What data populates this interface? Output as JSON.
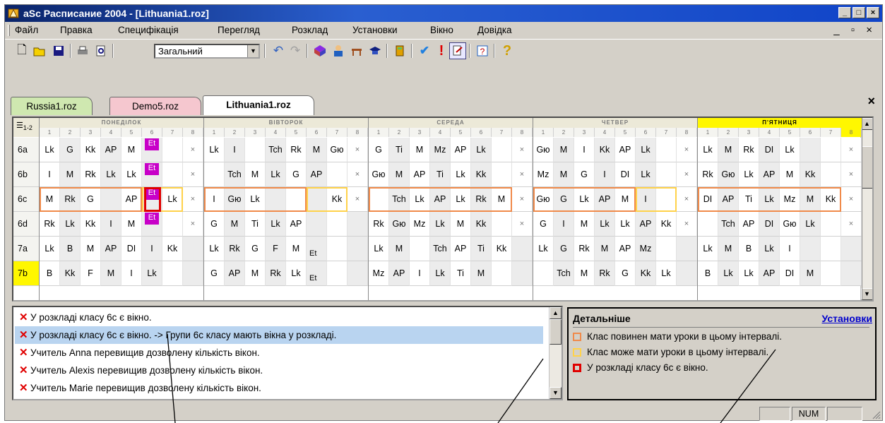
{
  "window": {
    "title": "aSc Расписание 2004  - [Lithuania1.roz]"
  },
  "menu": [
    "Файл",
    "Правка",
    "Специфікація",
    "Перегляд",
    "Розклад",
    "Установки",
    "Вікно",
    "Довідка"
  ],
  "toolbar": {
    "combo_value": "Загальний",
    "buttons": [
      "new-icon",
      "open-icon",
      "save-icon",
      "print-icon",
      "preview-icon",
      "undo-icon",
      "redo-icon",
      "subjects-icon",
      "teachers-icon",
      "classrooms-icon",
      "classes-icon",
      "generate-icon",
      "check-icon",
      "warning-icon",
      "edit-cards-icon",
      "help-tips-icon",
      "help-icon"
    ]
  },
  "tabs": [
    {
      "label": "Russia1.roz",
      "color": "#cfe8b0",
      "active": false
    },
    {
      "label": "Demo5.roz",
      "color": "#f5c7cf",
      "active": false
    },
    {
      "label": "Lithuania1.roz",
      "color": "#ffffff",
      "active": true
    }
  ],
  "grid": {
    "corner_label": "1-2",
    "days": [
      {
        "name": "ПОНЕДІЛОК",
        "highlight": false
      },
      {
        "name": "ВІВТОРОК",
        "highlight": false
      },
      {
        "name": "СЕРЕДА",
        "highlight": false
      },
      {
        "name": "ЧЕТВЕР",
        "highlight": false
      },
      {
        "name": "П'ЯТНИЦЯ",
        "highlight": true
      }
    ],
    "periods": [
      "1",
      "2",
      "3",
      "4",
      "5",
      "6",
      "7",
      "8"
    ],
    "rows": [
      {
        "cls": "6a",
        "days": [
          [
            "Lk",
            "G",
            "Kk",
            "AP",
            "M",
            "",
            "",
            "×"
          ],
          [
            "Lk",
            "I",
            "",
            "Tch",
            "Rk",
            "M",
            "Gю",
            "×"
          ],
          [
            "G",
            "Ti",
            "M",
            "Mz",
            "AP",
            "Lk",
            "",
            "×"
          ],
          [
            "Gю",
            "M",
            "I",
            "Kk",
            "AP",
            "Lk",
            "",
            "×"
          ],
          [
            "Lk",
            "M",
            "Rk",
            "DI",
            "Lk",
            "",
            "",
            "×"
          ]
        ]
      },
      {
        "cls": "6b",
        "days": [
          [
            "I",
            "M",
            "Rk",
            "Lk",
            "Lk",
            "",
            "",
            "×"
          ],
          [
            "",
            "Tch",
            "M",
            "Lk",
            "G",
            "AP",
            "",
            "×"
          ],
          [
            "Gю",
            "M",
            "AP",
            "Ti",
            "Lk",
            "Kk",
            "",
            "×"
          ],
          [
            "Mz",
            "M",
            "G",
            "I",
            "DI",
            "Lk",
            "",
            "×"
          ],
          [
            "Rk",
            "Gю",
            "Lk",
            "AP",
            "M",
            "Kk",
            "",
            "×"
          ]
        ]
      },
      {
        "cls": "6c",
        "days": [
          [
            "M",
            "Rk",
            "G",
            "",
            "AP",
            "",
            "Lk",
            "×"
          ],
          [
            "I",
            "Gю",
            "Lk",
            "",
            "",
            "",
            "Kk",
            "×"
          ],
          [
            "",
            "Tch",
            "Lk",
            "AP",
            "Lk",
            "Rk",
            "M",
            "×"
          ],
          [
            "Gю",
            "G",
            "Lk",
            "AP",
            "M",
            "I",
            "",
            "×"
          ],
          [
            "DI",
            "AP",
            "Ti",
            "Lk",
            "Mz",
            "M",
            "Kk",
            "×"
          ]
        ]
      },
      {
        "cls": "6d",
        "days": [
          [
            "Rk",
            "Lk",
            "Kk",
            "I",
            "M",
            "",
            "",
            "×"
          ],
          [
            "G",
            "M",
            "Ti",
            "Lk",
            "AP",
            "",
            "",
            ""
          ],
          [
            "Rk",
            "Gю",
            "Mz",
            "Lk",
            "M",
            "Kk",
            "",
            "×"
          ],
          [
            "G",
            "I",
            "M",
            "Lk",
            "Lk",
            "AP",
            "Kk",
            "×"
          ],
          [
            "",
            "Tch",
            "AP",
            "DI",
            "Gю",
            "Lk",
            "",
            "×"
          ]
        ]
      },
      {
        "cls": "7a",
        "days": [
          [
            "Lk",
            "B",
            "M",
            "AP",
            "DI",
            "I",
            "Kk",
            ""
          ],
          [
            "Lk",
            "Rk",
            "G",
            "F",
            "M",
            "",
            "",
            ""
          ],
          [
            "Lk",
            "M",
            "",
            "Tch",
            "AP",
            "Ti",
            "Kk",
            ""
          ],
          [
            "Lk",
            "G",
            "Rk",
            "M",
            "AP",
            "Mz",
            "",
            ""
          ],
          [
            "Lk",
            "M",
            "B",
            "Lk",
            "I",
            "",
            "",
            ""
          ]
        ]
      },
      {
        "cls": "7b",
        "days": [
          [
            "B",
            "Kk",
            "F",
            "M",
            "I",
            "Lk",
            "",
            ""
          ],
          [
            "G",
            "AP",
            "M",
            "Rk",
            "Lk",
            "",
            "",
            ""
          ],
          [
            "Mz",
            "AP",
            "I",
            "Lk",
            "Ti",
            "M",
            "",
            ""
          ],
          [
            "",
            "Tch",
            "M",
            "Rk",
            "G",
            "Kk",
            "Lk",
            ""
          ],
          [
            "B",
            "Lk",
            "Lk",
            "AP",
            "DI",
            "M",
            "",
            ""
          ]
        ]
      }
    ],
    "et_label": "Et"
  },
  "messages": [
    "У розкладі класу 6c є вікно.",
    "У розкладі класу 6c є вікно. -> Групи 6c класу мають вікна у розкладі.",
    "Учитель Anna перевищив дозволену кількість вікон.",
    "Учитель Alexis перевищив дозволену кількість вікон.",
    "Учитель Marie перевищив дозволену кількість вікон."
  ],
  "detail": {
    "title": "Детальніше",
    "link": "Установки",
    "legend": [
      {
        "text": "Клас повинен мати уроки в цьому інтервалі.",
        "color": "#f08a4a"
      },
      {
        "text": "Клас може мати уроки в цьому інтервалі.",
        "color": "#ffd24a"
      },
      {
        "text": "У розкладі класу 6c є вікно.",
        "color": "#e00000"
      }
    ]
  },
  "status": {
    "num": "NUM"
  },
  "colors": {
    "title_bar": "#0a246a",
    "selected_message": "#b9d4f0",
    "highlight_day": "#fff700"
  }
}
